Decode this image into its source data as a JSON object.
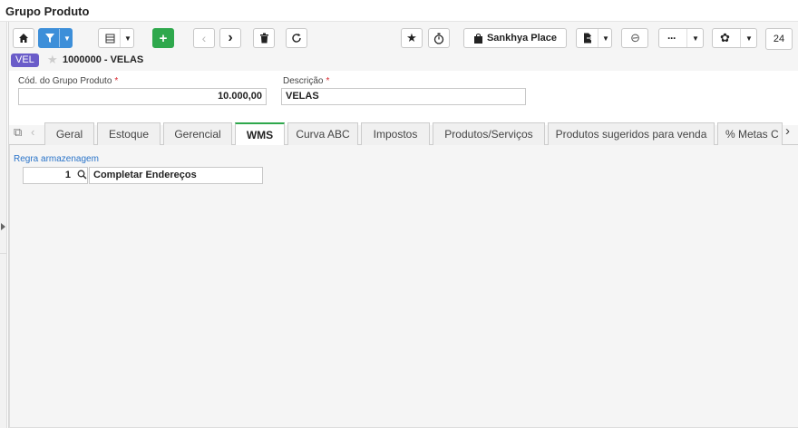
{
  "window": {
    "title": "Grupo Produto"
  },
  "toolbar": {
    "sankhya_place_label": "Sankhya Place",
    "counter_value": "24"
  },
  "record": {
    "tag": "VEL",
    "title": "1000000 - VELAS"
  },
  "form": {
    "code_label": "Cód. do Grupo Produto",
    "code_value": "10.000,00",
    "description_label": "Descrição",
    "description_value": "VELAS",
    "required_mark": "*"
  },
  "tabs": [
    {
      "label": "Geral"
    },
    {
      "label": "Estoque"
    },
    {
      "label": "Gerencial"
    },
    {
      "label": "WMS",
      "active": true
    },
    {
      "label": "Curva ABC"
    },
    {
      "label": "Impostos"
    },
    {
      "label": "Produtos/Serviços"
    },
    {
      "label": "Produtos sugeridos para venda"
    },
    {
      "label": "% Metas C"
    }
  ],
  "wms": {
    "rule_label": "Regra armazenagem",
    "rule_code": "1",
    "rule_description": "Completar Endereços"
  },
  "colors": {
    "primary_blue": "#3d8fd9",
    "add_green": "#2ea84c",
    "tag_purple": "#6a5cc9",
    "required_red": "#d9272e",
    "link_blue": "#2a74c9"
  }
}
